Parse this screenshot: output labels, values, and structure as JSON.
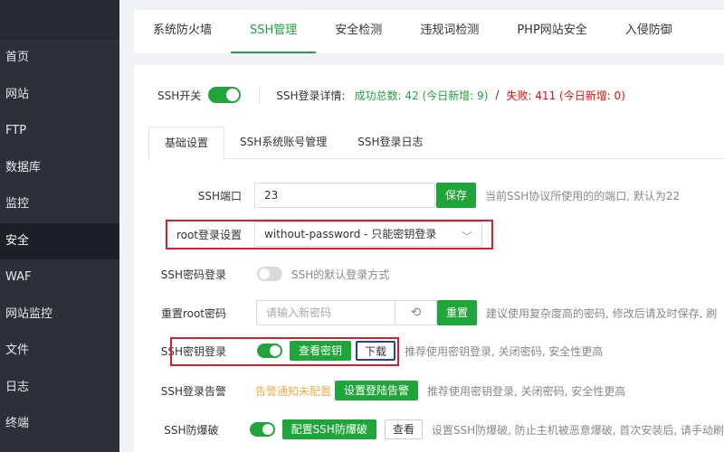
{
  "sidebar": {
    "items": [
      {
        "label": "首页"
      },
      {
        "label": "网站"
      },
      {
        "label": "FTP"
      },
      {
        "label": "数据库"
      },
      {
        "label": "监控"
      },
      {
        "label": "安全"
      },
      {
        "label": "WAF"
      },
      {
        "label": "网站监控"
      },
      {
        "label": "文件"
      },
      {
        "label": "日志"
      },
      {
        "label": "终端"
      }
    ],
    "active_index": 5
  },
  "tabs": [
    {
      "label": "系统防火墙"
    },
    {
      "label": "SSH管理"
    },
    {
      "label": "安全检测"
    },
    {
      "label": "违规词检测"
    },
    {
      "label": "PHP网站安全"
    },
    {
      "label": "入侵防御"
    }
  ],
  "status": {
    "ssh_switch_label": "SSH开关",
    "ssh_enabled": true,
    "login_detail_label": "SSH登录详情:",
    "success_text": "成功总数: 42 (今日新增: 9)",
    "separator": "/",
    "fail_text": "失败: 411 (今日新增: 0)"
  },
  "subtabs": [
    {
      "label": "基础设置"
    },
    {
      "label": "SSH系统账号管理"
    },
    {
      "label": "SSH登录日志"
    }
  ],
  "settings": {
    "port": {
      "label": "SSH端口",
      "value": "23",
      "button": "保存",
      "hint": "当前SSH协议所使用的的端口, 默认为22"
    },
    "root_login": {
      "label": "root登录设置",
      "value": "without-password - 只能密钥登录"
    },
    "password_login": {
      "label": "SSH密码登录",
      "enabled": false,
      "hint": "SSH的默认登录方式"
    },
    "reset_root": {
      "label": "重置root密码",
      "placeholder": "请输入新密码",
      "button": "重置",
      "hint": "建议使用复杂度高的密码, 修改后请及时保存, 刷"
    },
    "key_login": {
      "label": "SSH密钥登录",
      "enabled": true,
      "view_button": "查看密钥",
      "download_button": "下载",
      "hint": "推荐使用密钥登录, 关闭密码, 安全性更高"
    },
    "login_alert": {
      "label": "SSH登录告警",
      "status": "告警通知未配置",
      "button": "设置登陆告警",
      "hint": "推荐使用密钥登录, 关闭密码, 安全性更高"
    },
    "brute_force": {
      "label": "SSH防爆破",
      "enabled": true,
      "button": "配置SSH防爆破",
      "view_button": "查看",
      "hint": "设置SSH防爆破, 防止主机被恶意爆破, 首次安装后, 请手动刷"
    }
  },
  "colors": {
    "accent": "#20a53a",
    "fail": "#ef0808",
    "warn": "#f0ad4e",
    "highlight_red": "#d81e2c",
    "highlight_blue": "#2a3bb5"
  }
}
